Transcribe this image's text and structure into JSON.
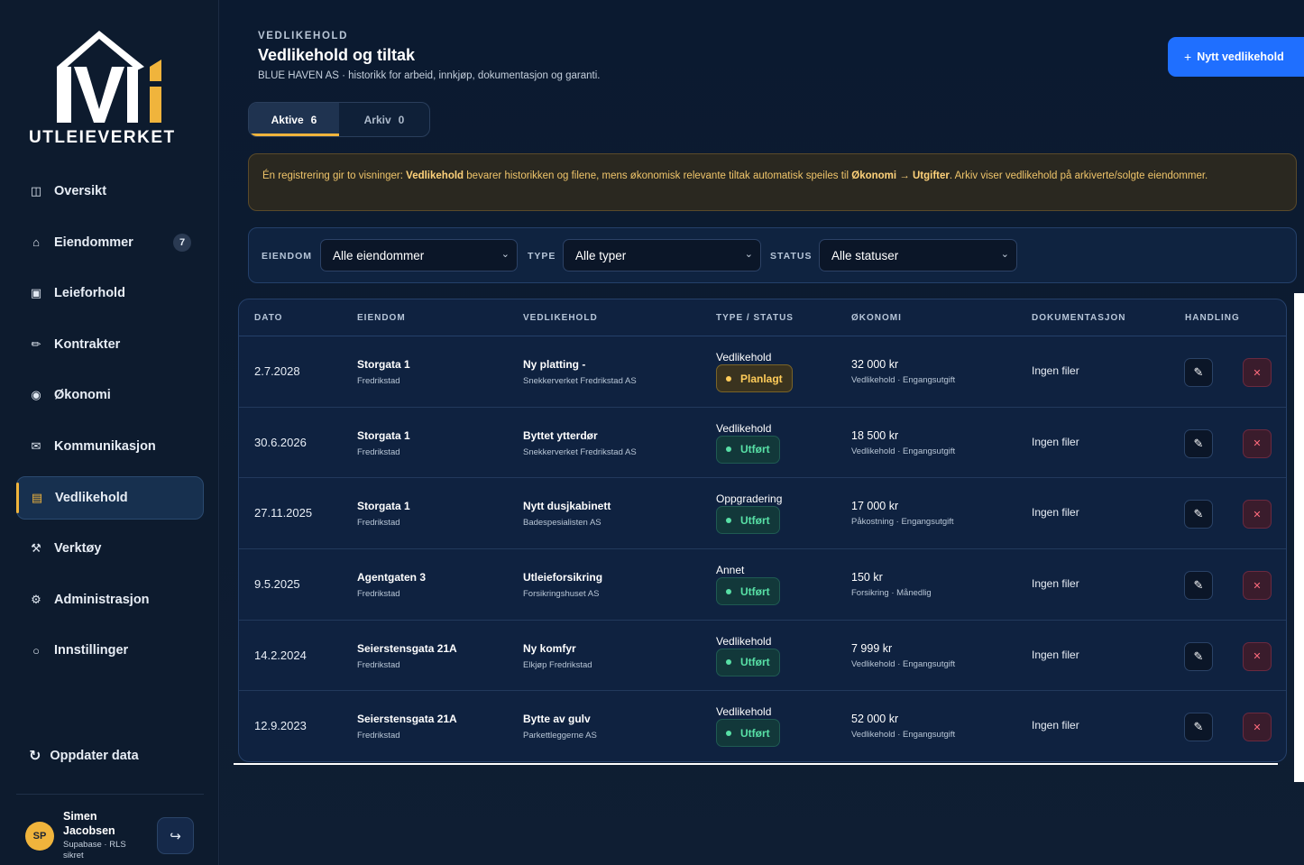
{
  "brand": {
    "name": "UTLEIEVERKET",
    "accent": "#f0b43c",
    "primary": "#1f6fff"
  },
  "sidebar": {
    "items": [
      {
        "label": "Oversikt",
        "icon": "columns-icon"
      },
      {
        "label": "Eiendommer",
        "icon": "home-icon",
        "badge": "7"
      },
      {
        "label": "Leieforhold",
        "icon": "square-icon"
      },
      {
        "label": "Kontrakter",
        "icon": "pen-icon"
      },
      {
        "label": "Økonomi",
        "icon": "globe-icon"
      },
      {
        "label": "Kommunikasjon",
        "icon": "mail-icon"
      },
      {
        "label": "Vedlikehold",
        "icon": "list-icon",
        "active": true
      },
      {
        "label": "Verktøy",
        "icon": "tools-icon"
      },
      {
        "label": "Administrasjon",
        "icon": "gear-icon"
      },
      {
        "label": "Innstillinger",
        "icon": "circle-icon"
      }
    ],
    "refresh_label": "Oppdater data",
    "user": {
      "initials": "SP",
      "name": "Simen Jacobsen",
      "sub": "Supabase · RLS sikret"
    }
  },
  "header": {
    "eyebrow": "VEDLIKEHOLD",
    "title": "Vedlikehold og tiltak",
    "subtitle": "BLUE HAVEN AS · historikk for arbeid, innkjøp, dokumentasjon og garanti.",
    "new_button": "Nytt vedlikehold"
  },
  "tabs": [
    {
      "label": "Aktive",
      "count": "6",
      "active": true
    },
    {
      "label": "Arkiv",
      "count": "0"
    }
  ],
  "notice": {
    "p1": "Én registrering gir to visninger: ",
    "b1": "Vedlikehold",
    "p2": " bevarer historikken og filene, mens økonomisk relevante tiltak automatisk speiles til ",
    "b2": "Økonomi → Utgifter",
    "p3": ". Arkiv viser vedlikehold på arkiverte/solgte eiendommer."
  },
  "filters": {
    "property_label": "EIENDOM",
    "property_value": "Alle eiendommer",
    "type_label": "TYPE",
    "type_value": "Alle typer",
    "status_label": "STATUS",
    "status_value": "Alle statuser"
  },
  "table": {
    "headers": [
      "DATO",
      "EIENDOM",
      "VEDLIKEHOLD",
      "TYPE / STATUS",
      "ØKONOMI",
      "DOKUMENTASJON",
      "HANDLING"
    ],
    "rows": [
      {
        "date": "2.7.2028",
        "property": "Storgata 1",
        "city": "Fredrikstad",
        "job": "Ny platting -",
        "vendor": "Snekkerverket Fredrikstad AS",
        "type": "Vedlikehold",
        "status": "Planlagt",
        "status_kind": "plan",
        "amount": "32 000 kr",
        "eco_sub": "Vedlikehold · Engangsutgift",
        "docs": "Ingen filer"
      },
      {
        "date": "30.6.2026",
        "property": "Storgata 1",
        "city": "Fredrikstad",
        "job": "Byttet ytterdør",
        "vendor": "Snekkerverket Fredrikstad AS",
        "type": "Vedlikehold",
        "status": "Utført",
        "status_kind": "done",
        "amount": "18 500 kr",
        "eco_sub": "Vedlikehold · Engangsutgift",
        "docs": "Ingen filer"
      },
      {
        "date": "27.11.2025",
        "property": "Storgata 1",
        "city": "Fredrikstad",
        "job": "Nytt dusjkabinett",
        "vendor": "Badespesialisten AS",
        "type": "Oppgradering",
        "status": "Utført",
        "status_kind": "done",
        "amount": "17 000 kr",
        "eco_sub": "Påkostning · Engangsutgift",
        "docs": "Ingen filer"
      },
      {
        "date": "9.5.2025",
        "property": "Agentgaten 3",
        "city": "Fredrikstad",
        "job": "Utleieforsikring",
        "vendor": "Forsikringshuset AS",
        "type": "Annet",
        "status": "Utført",
        "status_kind": "done",
        "amount": "150 kr",
        "eco_sub": "Forsikring · Månedlig",
        "docs": "Ingen filer"
      },
      {
        "date": "14.2.2024",
        "property": "Seierstensgata 21A",
        "city": "Fredrikstad",
        "job": "Ny komfyr",
        "vendor": "Elkjøp Fredrikstad",
        "type": "Vedlikehold",
        "status": "Utført",
        "status_kind": "done",
        "amount": "7 999 kr",
        "eco_sub": "Vedlikehold · Engangsutgift",
        "docs": "Ingen filer"
      },
      {
        "date": "12.9.2023",
        "property": "Seierstensgata 21A",
        "city": "Fredrikstad",
        "job": "Bytte av gulv",
        "vendor": "Parkettleggerne AS",
        "type": "Vedlikehold",
        "status": "Utført",
        "status_kind": "done",
        "amount": "52 000 kr",
        "eco_sub": "Vedlikehold · Engangsutgift",
        "docs": "Ingen filer"
      }
    ]
  }
}
